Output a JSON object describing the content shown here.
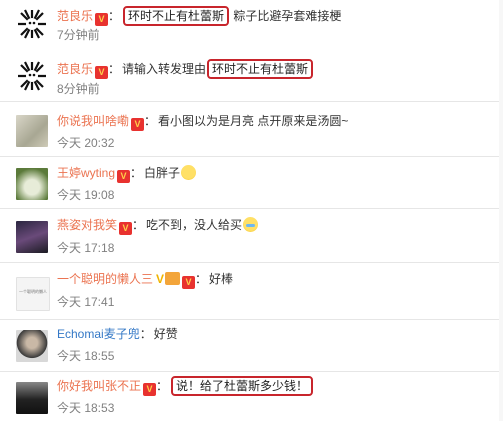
{
  "comments": [
    {
      "name": "范良乐",
      "vip": "V",
      "text_before": "",
      "highlight": "环时不止有杜蕾斯",
      "text_after": "粽子比避孕套难接梗",
      "time": "7分钟前"
    },
    {
      "name": "范良乐",
      "vip": "V",
      "text_before": "请输入转发理由",
      "highlight": "环时不止有杜蕾斯",
      "text_after": "",
      "time": "8分钟前"
    },
    {
      "name": "你说我叫啥嘞",
      "vip": "V",
      "text_before": "看小图以为是月亮 点开原来是汤圆~",
      "time": "今天 20:32"
    },
    {
      "name": "王婷wyting",
      "vip": "V",
      "text_before": "白胖子",
      "emoji": "smile-emoji",
      "time": "今天 19:08"
    },
    {
      "name": "燕姿对我笑",
      "vip": "V",
      "text_before": "吃不到，没人给买",
      "emoji": "cry-emoji",
      "time": "今天 17:18"
    },
    {
      "name": "一个聪明的懒人三",
      "badge": "V",
      "vip": "V",
      "text_before": "好棒",
      "time": "今天 17:41",
      "avatar_text": "一个聪明的懒人"
    },
    {
      "name": "Echomai麦子兜",
      "text_before": "好赞",
      "time": "今天 18:55"
    },
    {
      "name": "你好我叫张不正",
      "vip": "V",
      "text_before": "",
      "highlight": "说！给了杜蕾斯多少钱！",
      "text_after": "",
      "time": "今天 18:53"
    }
  ],
  "colors": {
    "name": "#eb7350",
    "name_alt": "#3478c6",
    "highlight_border": "#c8252c",
    "time": "#808080"
  }
}
